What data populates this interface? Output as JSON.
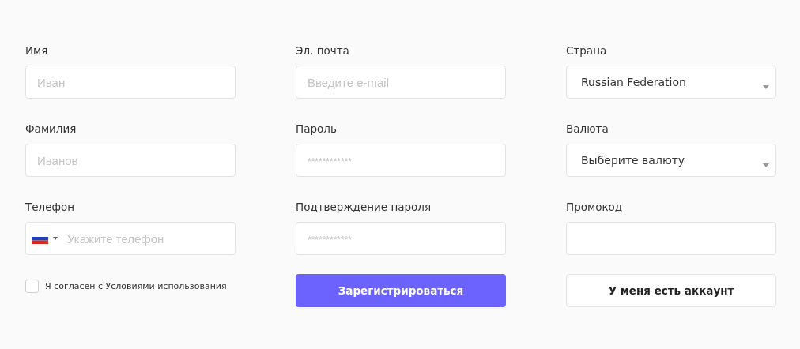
{
  "fields": [
    {
      "kind": "text",
      "label": "Имя",
      "placeholder": "Иван"
    },
    {
      "kind": "text",
      "label": "Эл. почта",
      "placeholder": "Введите e-mail"
    },
    {
      "kind": "select",
      "label": "Страна",
      "value": "Russian Federation"
    },
    {
      "kind": "text",
      "label": "Фамилия",
      "placeholder": "Иванов"
    },
    {
      "kind": "password",
      "label": "Пароль",
      "placeholder": "************"
    },
    {
      "kind": "select",
      "label": "Валюта",
      "value": "Выберите валюту"
    },
    {
      "kind": "phone",
      "label": "Телефон",
      "placeholder": "Укажите телефон"
    },
    {
      "kind": "password",
      "label": "Подтверждение пароля",
      "placeholder": "************"
    },
    {
      "kind": "text",
      "label": "Промокод"
    }
  ],
  "agreement": {
    "label": "Я согласен с Условиями использования",
    "checked": false
  },
  "buttons": [
    {
      "kind": "primary",
      "label": "Зарегистрироваться"
    },
    {
      "kind": "secondary",
      "label": "У меня есть аккаунт"
    }
  ]
}
